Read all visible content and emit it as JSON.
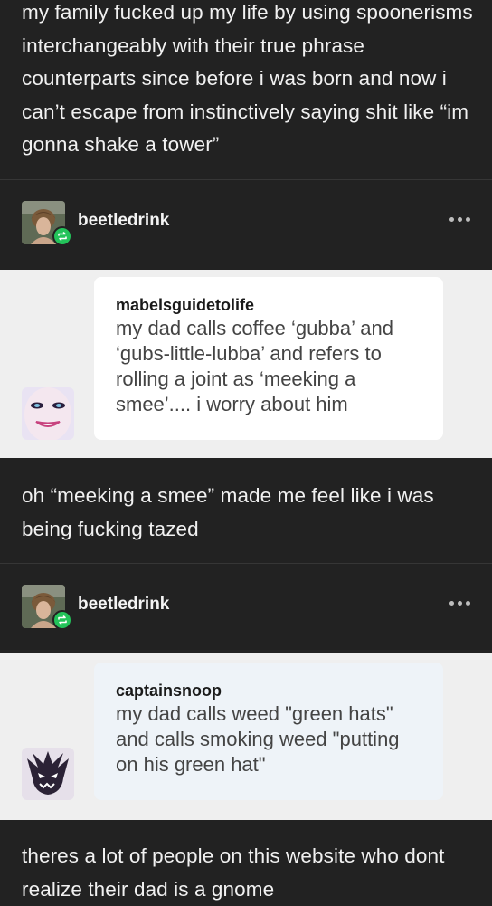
{
  "posts": [
    {
      "text": "my family fucked up my life by using spoonerisms interchangeably with their true phrase counterparts since before i was born and now i can’t escape from instinctively saying shit like “im gonna shake a tower”"
    },
    {
      "text": "oh “meeking a smee” made me feel like i was being fucking tazed"
    },
    {
      "text": "theres a lot of people on this website who dont realize their dad is a gnome"
    }
  ],
  "reblogs": [
    {
      "username": "beetledrink",
      "more_icon": "ellipsis-icon",
      "badge_icon": "reblog-icon"
    },
    {
      "username": "beetledrink",
      "more_icon": "ellipsis-icon",
      "badge_icon": "reblog-icon"
    }
  ],
  "asks": [
    {
      "asker": "mabelsguidetolife",
      "text": "my dad calls coffee ‘gubba’ and ‘gubs-little-lubba’ and refers to rolling a joint as ‘meeking a smee’.... i worry about him"
    },
    {
      "asker": "captainsnoop",
      "text": "my dad calls weed \"green hats\" and calls smoking weed \"putting on his green hat\""
    }
  ],
  "colors": {
    "background": "#222222",
    "ask_background": "#efefef",
    "reblog_badge": "#23c35a"
  }
}
